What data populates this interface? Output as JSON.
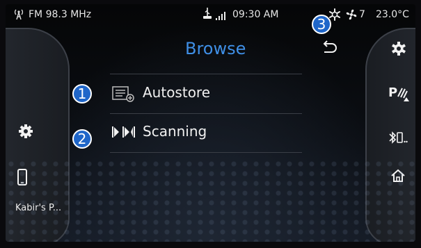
{
  "status_bar": {
    "radio_station": "FM 98.3 MHz",
    "time": "09:30 AM",
    "fan_speed": "7",
    "temperature": "23.0°C"
  },
  "main": {
    "title": "Browse",
    "items": [
      {
        "label": "Autostore",
        "icon": "autostore-list-icon"
      },
      {
        "label": "Scanning",
        "icon": "scan-icon"
      }
    ]
  },
  "left_panel": {
    "phone_label": "Kabir's P..."
  },
  "right_panel": {
    "icons": [
      "climate-icon",
      "parking-assist-icon",
      "bluetooth-phone-icon",
      "home-icon"
    ]
  },
  "annotations": [
    "1",
    "2",
    "3"
  ],
  "colors": {
    "accent": "#3f8fe6",
    "badge": "#1f66c9",
    "background": "#0b0e13"
  }
}
